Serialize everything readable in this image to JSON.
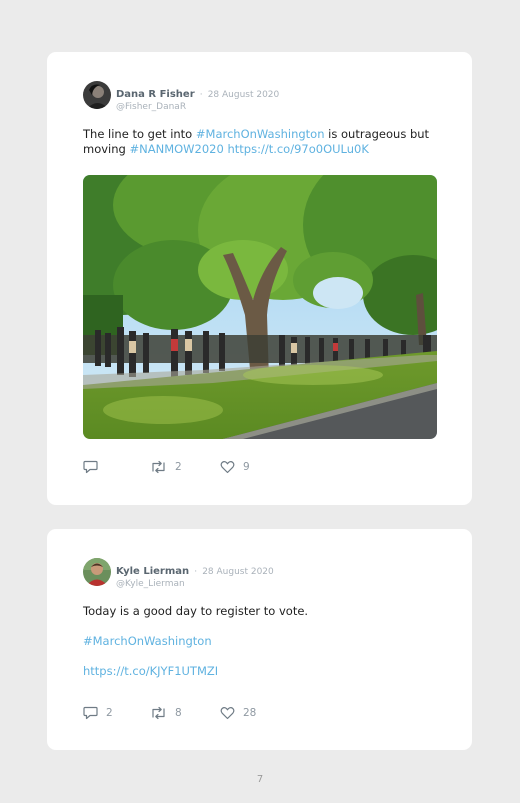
{
  "tweets": [
    {
      "author": "Dana R Fisher",
      "separator": "·",
      "date": "28 August 2020",
      "handle": "@Fisher_DanaR",
      "text": {
        "part1": "The line to get into ",
        "hashtag1": "#MarchOnWashington",
        "part2": " is outrageous but moving ",
        "hashtag2": "#NANMOW2020",
        "space": " ",
        "link": "https://t.co/97o0OULu0K"
      },
      "image_description": "photo-line-of-people-under-trees",
      "counts": {
        "reply": "",
        "retweet": "2",
        "like": "9"
      },
      "icons": {
        "reply": "reply-icon",
        "retweet": "retweet-icon",
        "like": "heart-icon"
      }
    },
    {
      "author": "Kyle Lierman",
      "separator": "·",
      "date": "28 August 2020",
      "handle": "@Kyle_Lierman",
      "text": {
        "line1": "Today is a good day to register to vote.",
        "hashtag": "#MarchOnWashington",
        "link": "https://t.co/KJYF1UTMZI"
      },
      "counts": {
        "reply": "2",
        "retweet": "8",
        "like": "28"
      },
      "icons": {
        "reply": "reply-icon",
        "retweet": "retweet-icon",
        "like": "heart-icon"
      }
    }
  ],
  "page_number": "7",
  "colors": {
    "background": "#ebebeb",
    "card": "#ffffff",
    "link": "#5fb2e0",
    "meta": "#aab2ba",
    "icon": "#6f7b85"
  }
}
